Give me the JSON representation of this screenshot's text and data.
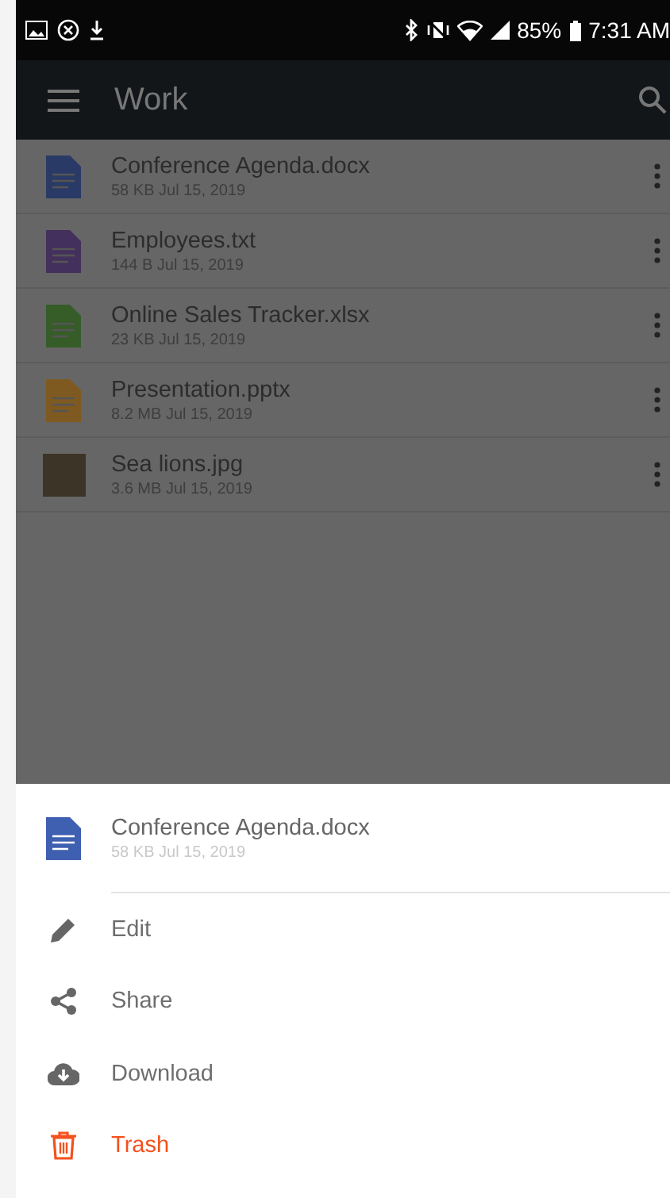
{
  "status_bar": {
    "battery": "85%",
    "time": "7:31 AM"
  },
  "app_bar": {
    "title": "Work"
  },
  "files": [
    {
      "kind": "doc",
      "name": "Conference Agenda.docx",
      "meta": "58 KB Jul 15, 2019"
    },
    {
      "kind": "txt",
      "name": "Employees.txt",
      "meta": "144 B Jul 15, 2019"
    },
    {
      "kind": "xls",
      "name": "Online Sales Tracker.xlsx",
      "meta": "23 KB Jul 15, 2019"
    },
    {
      "kind": "ppt",
      "name": "Presentation.pptx",
      "meta": "8.2 MB Jul 15, 2019"
    },
    {
      "kind": "photo",
      "name": "Sea lions.jpg",
      "meta": "3.6 MB Jul 15, 2019"
    }
  ],
  "bottom_sheet": {
    "file": {
      "kind": "doc",
      "name": "Conference Agenda.docx",
      "meta": "58 KB Jul 15, 2019"
    },
    "actions": [
      {
        "kind": "edit",
        "label": "Edit"
      },
      {
        "kind": "share",
        "label": "Share"
      },
      {
        "kind": "download",
        "label": "Download"
      },
      {
        "kind": "trash",
        "label": "Trash"
      }
    ]
  }
}
